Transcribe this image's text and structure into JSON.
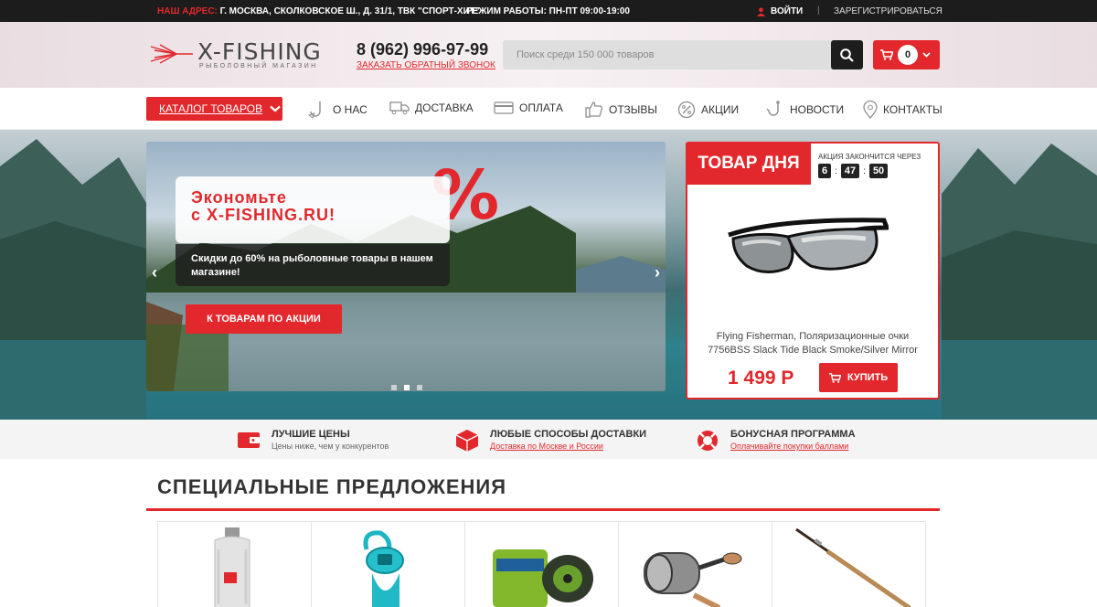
{
  "topbar": {
    "address_label": "НАШ АДРЕС:",
    "address": "Г. МОСКВА, СКОЛКОВСКОЕ Ш., Д. 31/1, ТВК \"СПОРТ-ХИТ\"",
    "hours": "РЕЖИМ РАБОТЫ: ПН-ПТ 09:00-19:00",
    "login": "ВОЙТИ",
    "separator": "|",
    "register": "ЗАРЕГИСТРИРОВАТЬСЯ"
  },
  "header": {
    "logo_name": "X-FISHING",
    "logo_tagline": "рыболовный магазин",
    "phone": "8 (962) 996-97-99",
    "callback": "ЗАКАЗАТЬ ОБРАТНЫЙ ЗВОНОК",
    "search_placeholder": "Поиск среди 150 000 товаров",
    "cart_count": "0"
  },
  "nav": {
    "catalog": "КАТАЛОГ ТОВАРОВ",
    "items": [
      {
        "label": "О НАС",
        "icon": "fish-hook-icon"
      },
      {
        "label": "ДОСТАВКА",
        "icon": "truck-icon"
      },
      {
        "label": "ОПЛАТА",
        "icon": "card-icon"
      },
      {
        "label": "ОТЗЫВЫ",
        "icon": "thumbs-up-icon"
      },
      {
        "label": "АКЦИИ",
        "icon": "percent-icon"
      },
      {
        "label": "НОВОСТИ",
        "icon": "hook-icon"
      },
      {
        "label": "КОНТАКТЫ",
        "icon": "map-pin-icon"
      }
    ]
  },
  "slider": {
    "headline": "Экономьте\nс X-FISHING.RU!",
    "subtext": "Скидки до 60% на рыболовные товары в нашем магазине!",
    "button": "К ТОВАРАМ ПО АКЦИИ",
    "percent_glyph": "%",
    "prev": "‹",
    "next": "›"
  },
  "deal": {
    "badge": "ТОВАР ДНЯ",
    "ends_label": "АКЦИЯ ЗАКОНЧИТСЯ ЧЕРЕЗ",
    "timer_hours": "6",
    "timer_minutes": "47",
    "timer_seconds": "50",
    "timer_sep": ":",
    "product_name": "Flying Fisherman, Поляризационные очки 7756BSS Slack Tide Black Smoke/Silver Mirror",
    "price": "1 499 Р",
    "buy": "КУПИТЬ"
  },
  "benefits": [
    {
      "title": "ЛУЧШИЕ ЦЕНЫ",
      "subtitle": "Цены ниже, чем у конкурентов",
      "icon": "wallet-icon"
    },
    {
      "title": "ЛЮБЫЕ СПОСОБЫ ДОСТАВКИ",
      "subtitle": "Доставка по Москве и России",
      "icon": "box-icon"
    },
    {
      "title": "БОНУСНАЯ ПРОГРАММА",
      "subtitle": "Оплачивайте покупки баллами",
      "icon": "lifebuoy-icon"
    }
  ],
  "section": {
    "title": "СПЕЦИАЛЬНЫЕ ПРЕДЛОЖЕНИЯ"
  },
  "colors": {
    "accent": "#e2282c",
    "dark": "#1c1c1c"
  }
}
